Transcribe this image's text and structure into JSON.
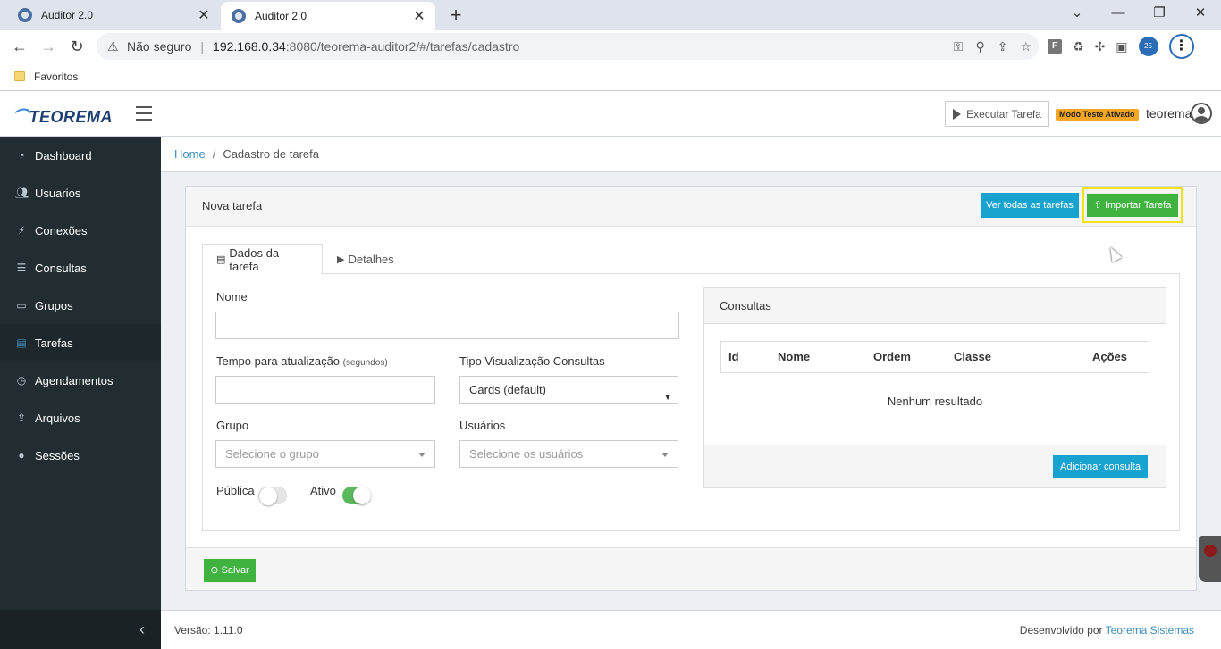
{
  "browser": {
    "tabs": [
      {
        "title": "Auditor 2.0",
        "close": "✕"
      },
      {
        "title": "Auditor 2.0",
        "close": "✕"
      }
    ],
    "new_tab": "+",
    "window_controls": {
      "minimize": "⌄",
      "min": "—",
      "restore": "❐",
      "close": "✕"
    },
    "address": {
      "security_label": "Não seguro",
      "separator": "|",
      "host": "192.168.0.34",
      "path": ":8080/teorema-auditor2/#/tarefas/cadastro"
    },
    "bookmark": "Favoritos",
    "extension_f": "F",
    "profile": "25"
  },
  "header": {
    "logo": "TEOREMA",
    "execute_button": "Executar Tarefa",
    "test_mode_badge": "Modo Teste Ativado",
    "user": "teorema"
  },
  "sidebar": {
    "items": [
      {
        "label": "Dashboard",
        "icon": "dashboard-icon"
      },
      {
        "label": "Usuarios",
        "icon": "users-icon"
      },
      {
        "label": "Conexões",
        "icon": "plug-icon"
      },
      {
        "label": "Consultas",
        "icon": "database-icon"
      },
      {
        "label": "Grupos",
        "icon": "folder-icon"
      },
      {
        "label": "Tarefas",
        "icon": "tasks-icon"
      },
      {
        "label": "Agendamentos",
        "icon": "clock-icon"
      },
      {
        "label": "Arquivos",
        "icon": "upload-icon"
      },
      {
        "label": "Sessões",
        "icon": "user-icon"
      }
    ],
    "active_index": 5,
    "collapse": "‹"
  },
  "breadcrumb": {
    "home": "Home",
    "separator": "/",
    "current": "Cadastro de tarefa"
  },
  "form": {
    "title": "Nova tarefa",
    "view_all_button": "Ver todas as tarefas",
    "import_button": "Importar Tarefa",
    "tabs": [
      {
        "label": "Dados da tarefa"
      },
      {
        "label": "Detalhes"
      }
    ],
    "nome_label": "Nome",
    "nome_value": "",
    "tempo_label": "Tempo para atualização",
    "tempo_hint": "(segundos)",
    "tempo_value": "",
    "tipo_label": "Tipo Visualização Consultas",
    "tipo_value": "Cards (default)",
    "grupo_label": "Grupo",
    "grupo_placeholder": "Selecione o grupo",
    "usuarios_label": "Usuários",
    "usuarios_placeholder": "Selecione os usuários",
    "publica_label": "Pública",
    "publica_on": false,
    "ativo_label": "Ativo",
    "ativo_on": true,
    "save_button": "Salvar"
  },
  "consultas": {
    "title": "Consultas",
    "columns": [
      "Id",
      "Nome",
      "Ordem",
      "Classe",
      "Ações"
    ],
    "empty_text": "Nenhum resultado",
    "add_button": "Adicionar consulta"
  },
  "footer": {
    "version": "Versão: 1.11.0",
    "developed_by": "Desenvolvido por",
    "company": "Teorema Sistemas"
  },
  "colors": {
    "sidebar_bg": "#222d32",
    "primary": "#17a2cf",
    "success": "#3fb23f",
    "link": "#3c8dbc",
    "badge": "#f5a623"
  }
}
